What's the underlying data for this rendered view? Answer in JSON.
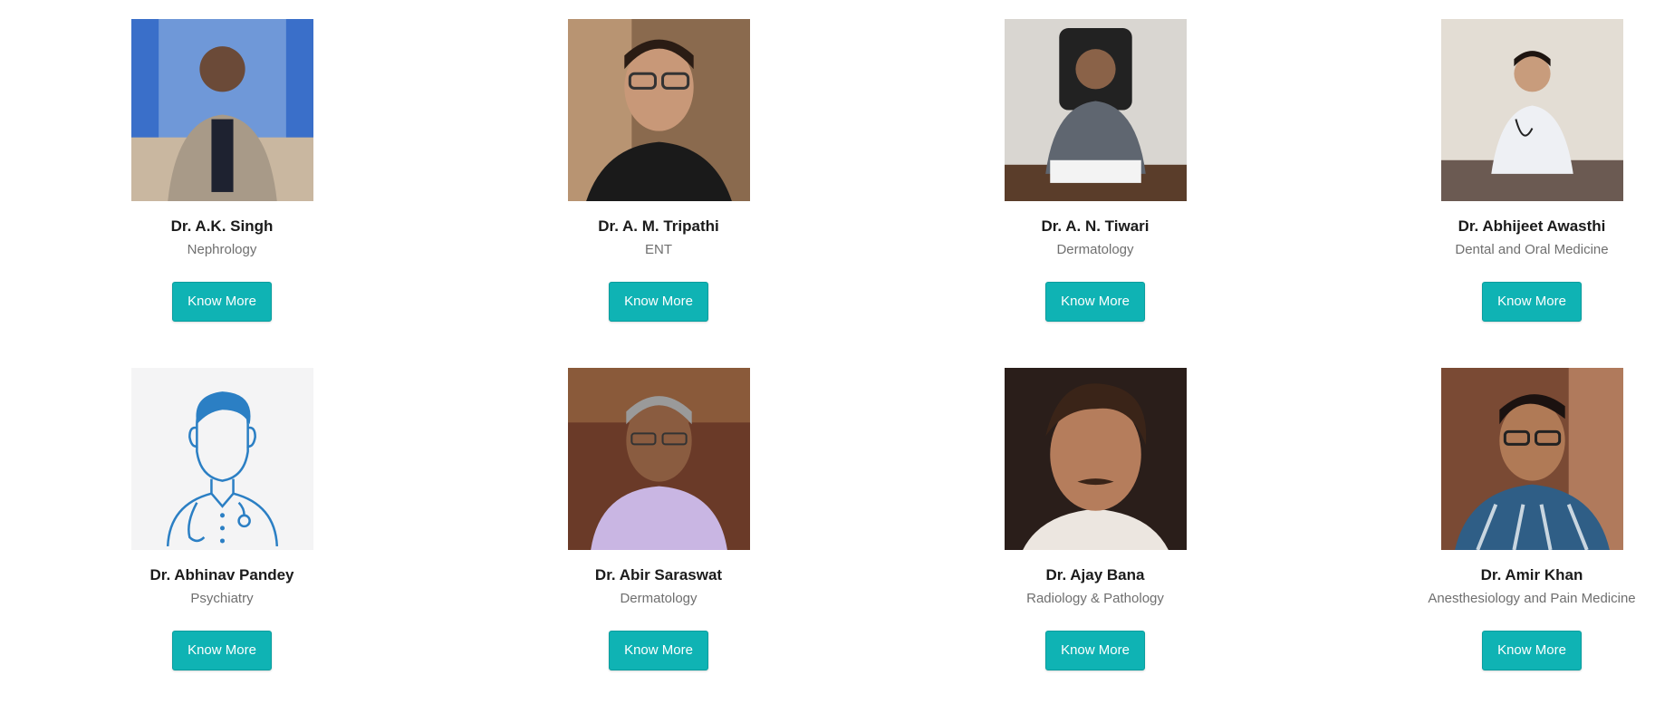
{
  "doctors": [
    {
      "name": "Dr. A.K. Singh",
      "specialty": "Nephrology",
      "button": "Know More",
      "icon": "doctor-photo-icon"
    },
    {
      "name": "Dr. A. M. Tripathi",
      "specialty": "ENT",
      "button": "Know More",
      "icon": "doctor-photo-icon"
    },
    {
      "name": "Dr. A. N. Tiwari",
      "specialty": "Dermatology",
      "button": "Know More",
      "icon": "doctor-photo-icon"
    },
    {
      "name": "Dr. Abhijeet Awasthi",
      "specialty": "Dental and Oral Medicine",
      "button": "Know More",
      "icon": "doctor-photo-icon"
    },
    {
      "name": "Dr. Abhinav Pandey",
      "specialty": "Psychiatry",
      "button": "Know More",
      "icon": "doctor-placeholder-icon"
    },
    {
      "name": "Dr. Abir Saraswat",
      "specialty": "Dermatology",
      "button": "Know More",
      "icon": "doctor-photo-icon"
    },
    {
      "name": "Dr. Ajay Bana",
      "specialty": "Radiology & Pathology",
      "button": "Know More",
      "icon": "doctor-photo-icon"
    },
    {
      "name": "Dr. Amir Khan",
      "specialty": "Anesthesiology and Pain Medicine",
      "button": "Know More",
      "icon": "doctor-photo-icon"
    }
  ],
  "colors": {
    "button_bg": "#0fb3b4",
    "button_text": "#ffffff",
    "name_text": "#1b1b1b",
    "specialty_text": "#6f6f6f",
    "placeholder_stroke": "#2b7fc4"
  }
}
